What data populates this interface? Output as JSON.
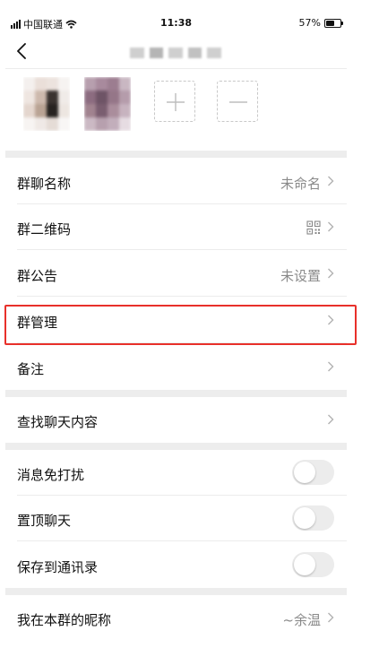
{
  "status_bar": {
    "carrier": "中国联通",
    "time": "11:38",
    "battery": "57%",
    "battery_level": 0.57
  },
  "nav": {
    "back_icon": "chevron-left-icon",
    "title": ""
  },
  "members": {
    "add_icon": "plus-icon",
    "remove_icon": "minus-icon"
  },
  "settings": {
    "group_name": {
      "label": "群聊名称",
      "value": "未命名"
    },
    "group_qr": {
      "label": "群二维码",
      "icon": "qr-code-icon"
    },
    "announcement": {
      "label": "群公告",
      "value": "未设置"
    },
    "manage": {
      "label": "群管理"
    },
    "remark": {
      "label": "备注"
    },
    "search_history": {
      "label": "查找聊天内容"
    },
    "mute": {
      "label": "消息免打扰",
      "on": false
    },
    "pin": {
      "label": "置顶聊天",
      "on": false
    },
    "save_contacts": {
      "label": "保存到通讯录",
      "on": false
    },
    "my_nickname": {
      "label": "我在本群的昵称",
      "value": "~余温"
    }
  },
  "colors": {
    "highlight": "#e8302a",
    "section_gap": "#ededed",
    "toggle_off": "#ececec"
  }
}
